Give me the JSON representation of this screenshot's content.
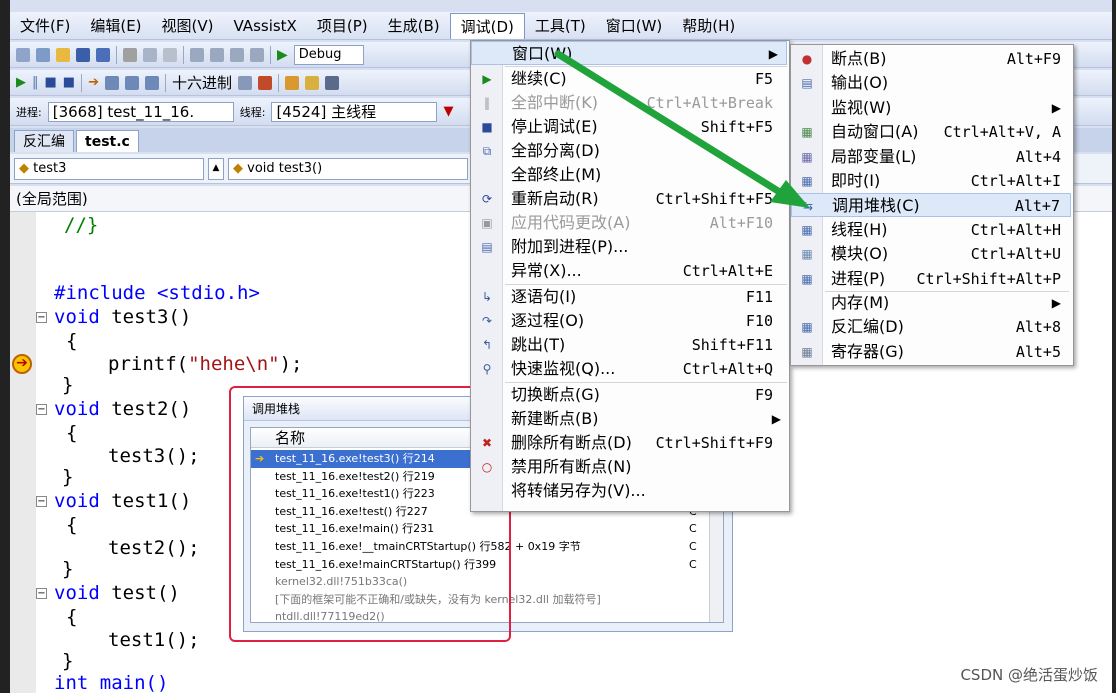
{
  "menubar": [
    "文件(F)",
    "编辑(E)",
    "视图(V)",
    "VAssistX",
    "项目(P)",
    "生成(B)",
    "调试(D)",
    "工具(T)",
    "窗口(W)",
    "帮助(H)"
  ],
  "toolbar": {
    "config_combo": "Debug",
    "hex_label": "十六进制",
    "process_label": "进程:",
    "process_value": "[3668] test_11_16.",
    "thread_label": "线程:",
    "thread_value": "[4524] 主线程"
  },
  "tabs": [
    "反汇编",
    "test.c"
  ],
  "navbar": {
    "left": "test3",
    "right": "void test3()"
  },
  "scope": "(全局范围)",
  "code": {
    "l1": "//}",
    "l2": "#include <stdio.h>",
    "l3_kw": "void",
    "l3_rest": " test3()",
    "l4": "{",
    "l5_a": "printf(",
    "l5_s": "\"hehe\\n\"",
    "l5_b": ");",
    "l6": "}",
    "l7_kw": "void",
    "l7_rest": " test2()",
    "l8": "{",
    "l9": "test3();",
    "l10": "}",
    "l11_kw": "void",
    "l11_rest": " test1()",
    "l12": "{",
    "l13": "test2();",
    "l14": "}",
    "l15_kw": "void",
    "l15_rest": " test()",
    "l16": "{",
    "l17": "test1();",
    "l18": "}",
    "l19": "int main()"
  },
  "debug_menu": [
    {
      "label": "窗口(W)",
      "shortcut": ""
    },
    {
      "label": "继续(C)",
      "shortcut": "F5"
    },
    {
      "label": "全部中断(K)",
      "shortcut": "Ctrl+Alt+Break"
    },
    {
      "label": "停止调试(E)",
      "shortcut": "Shift+F5"
    },
    {
      "label": "全部分离(D)",
      "shortcut": ""
    },
    {
      "label": "全部终止(M)",
      "shortcut": ""
    },
    {
      "label": "重新启动(R)",
      "shortcut": "Ctrl+Shift+F5"
    },
    {
      "label": "应用代码更改(A)",
      "shortcut": "Alt+F10"
    },
    {
      "label": "附加到进程(P)...",
      "shortcut": ""
    },
    {
      "label": "异常(X)...",
      "shortcut": "Ctrl+Alt+E"
    },
    {
      "label": "逐语句(I)",
      "shortcut": "F11"
    },
    {
      "label": "逐过程(O)",
      "shortcut": "F10"
    },
    {
      "label": "跳出(T)",
      "shortcut": "Shift+F11"
    },
    {
      "label": "快速监视(Q)...",
      "shortcut": "Ctrl+Alt+Q"
    },
    {
      "label": "切换断点(G)",
      "shortcut": "F9"
    },
    {
      "label": "新建断点(B)",
      "shortcut": ""
    },
    {
      "label": "删除所有断点(D)",
      "shortcut": "Ctrl+Shift+F9"
    },
    {
      "label": "禁用所有断点(N)",
      "shortcut": ""
    },
    {
      "label": "将转储另存为(V)...",
      "shortcut": ""
    }
  ],
  "window_menu": [
    {
      "label": "断点(B)",
      "shortcut": "Alt+F9"
    },
    {
      "label": "输出(O)",
      "shortcut": ""
    },
    {
      "label": "监视(W)",
      "shortcut": ""
    },
    {
      "label": "自动窗口(A)",
      "shortcut": "Ctrl+Alt+V, A"
    },
    {
      "label": "局部变量(L)",
      "shortcut": "Alt+4"
    },
    {
      "label": "即时(I)",
      "shortcut": "Ctrl+Alt+I"
    },
    {
      "label": "调用堆栈(C)",
      "shortcut": "Alt+7"
    },
    {
      "label": "线程(H)",
      "shortcut": "Ctrl+Alt+H"
    },
    {
      "label": "模块(O)",
      "shortcut": "Ctrl+Alt+U"
    },
    {
      "label": "进程(P)",
      "shortcut": "Ctrl+Shift+Alt+P"
    },
    {
      "label": "内存(M)",
      "shortcut": ""
    },
    {
      "label": "反汇编(D)",
      "shortcut": "Alt+8"
    },
    {
      "label": "寄存器(G)",
      "shortcut": "Alt+5"
    }
  ],
  "callstack": {
    "title": "调用堆栈",
    "header": "名称",
    "rows": [
      {
        "name": "test_11_16.exe!test3() 行214",
        "lang": ""
      },
      {
        "name": "test_11_16.exe!test2() 行219",
        "lang": "C"
      },
      {
        "name": "test_11_16.exe!test1() 行223",
        "lang": "C"
      },
      {
        "name": "test_11_16.exe!test() 行227",
        "lang": "C"
      },
      {
        "name": "test_11_16.exe!main() 行231",
        "lang": "C"
      },
      {
        "name": "test_11_16.exe!__tmainCRTStartup() 行582 + 0x19 字节",
        "lang": "C"
      },
      {
        "name": "test_11_16.exe!mainCRTStartup() 行399",
        "lang": "C"
      },
      {
        "name": "kernel32.dll!751b33ca()",
        "lang": ""
      },
      {
        "name": "[下面的框架可能不正确和/或缺失，没有为 kernel32.dll 加载符号]",
        "lang": ""
      },
      {
        "name": "ntdll.dll!77119ed2()",
        "lang": ""
      }
    ]
  },
  "watermark": "CSDN @绝活蛋炒饭",
  "colors": {
    "accent_arrow": "#1fa33a",
    "highlight_box": "#e02040",
    "selection": "#3b6fd0"
  }
}
